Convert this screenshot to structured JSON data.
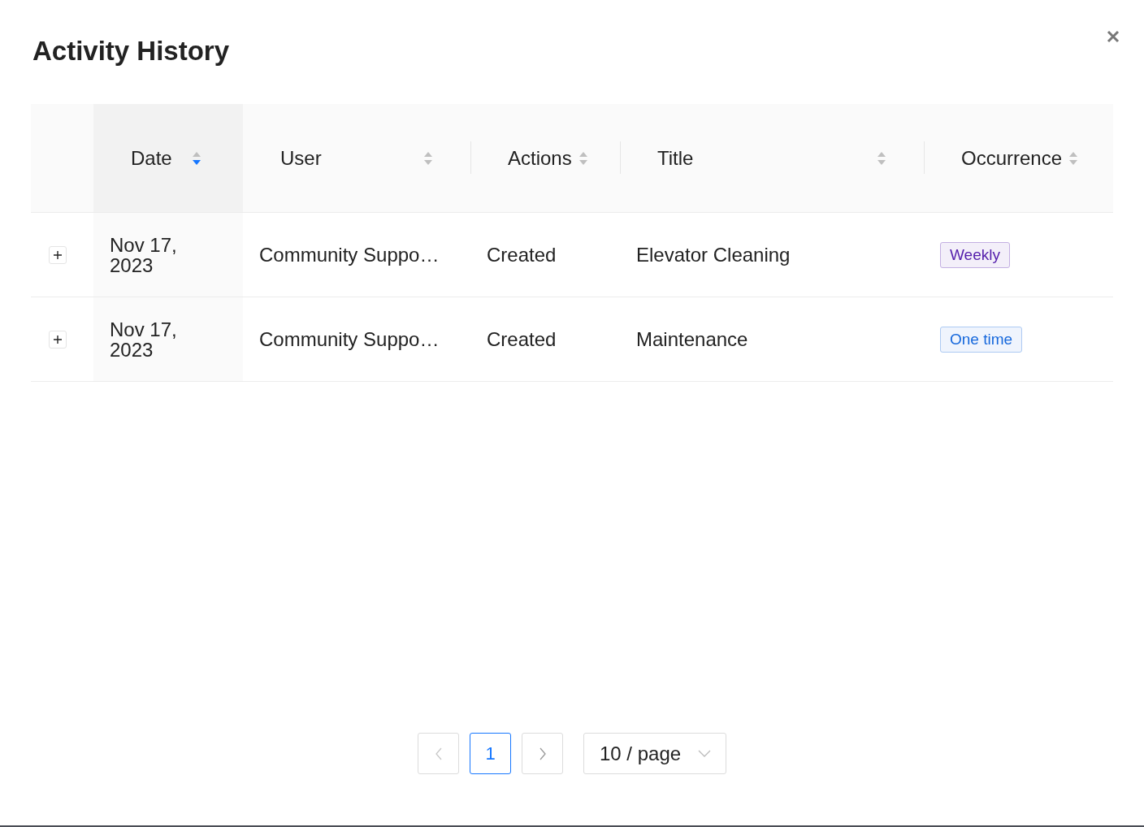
{
  "dialog": {
    "title": "Activity History"
  },
  "table": {
    "columns": [
      {
        "label": "Date",
        "sorted": true
      },
      {
        "label": "User",
        "sorted": false
      },
      {
        "label": "Actions",
        "sorted": false
      },
      {
        "label": "Title",
        "sorted": false
      },
      {
        "label": "Occurrence",
        "sorted": false
      }
    ],
    "rows": [
      {
        "expanded": false,
        "date": "Nov 17, 2023",
        "user": "Community Suppo…",
        "action": "Created",
        "title": "Elevator Cleaning",
        "occurrence": {
          "label": "Weekly",
          "color": "#531dab"
        }
      },
      {
        "expanded": false,
        "date": "Nov 17, 2023",
        "user": "Community Suppo…",
        "action": "Created",
        "title": "Maintenance",
        "occurrence": {
          "label": "One time",
          "color": "#1668dc"
        }
      }
    ]
  },
  "pagination": {
    "pages": [
      {
        "label": "1",
        "selected": true
      }
    ],
    "previous_disabled": true,
    "next_disabled": false,
    "page_size": "10 / page"
  }
}
